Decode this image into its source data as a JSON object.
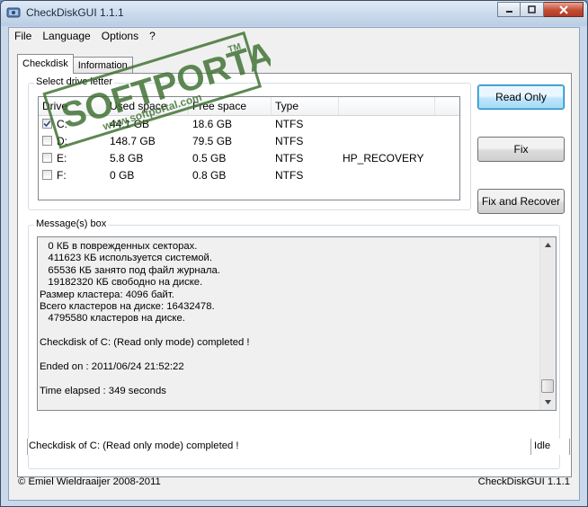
{
  "window": {
    "title": "CheckDiskGUI 1.1.1"
  },
  "menu": {
    "items": [
      "File",
      "Language",
      "Options",
      "?"
    ]
  },
  "tabs": [
    {
      "label": "Checkdisk",
      "active": true
    },
    {
      "label": "Information",
      "active": false
    }
  ],
  "drives": {
    "group_label": "Select drive letter",
    "columns": [
      "Drive",
      "Used space",
      "Free space",
      "Type",
      ""
    ],
    "rows": [
      {
        "drive": "C:",
        "used": "44.1 GB",
        "free": "18.6 GB",
        "type": "NTFS",
        "label": "",
        "checked": true
      },
      {
        "drive": "D:",
        "used": "148.7 GB",
        "free": "79.5 GB",
        "type": "NTFS",
        "label": "",
        "checked": false
      },
      {
        "drive": "E:",
        "used": "5.8 GB",
        "free": "0.5 GB",
        "type": "NTFS",
        "label": "HP_RECOVERY",
        "checked": false
      },
      {
        "drive": "F:",
        "used": "0 GB",
        "free": "0.8 GB",
        "type": "NTFS",
        "label": "",
        "checked": false
      }
    ]
  },
  "buttons": {
    "read_only": "Read Only",
    "fix": "Fix",
    "fix_recover": "Fix and Recover"
  },
  "messages": {
    "group_label": "Message(s) box",
    "lines": [
      "   0 КБ в поврежденных секторах.",
      "   411623 КБ используется системой.",
      "   65536 КБ занято под файл журнала.",
      "   19182320 КБ свободно на диске.",
      "Размер кластера: 4096 байт.",
      "Всего кластеров на диске: 16432478.",
      "   4795580 кластеров на диске.",
      "",
      "Checkdisk of C: (Read only mode) completed !",
      "",
      "Ended on : 2011/06/24 21:52:22",
      "",
      "Time elapsed : 349 seconds"
    ]
  },
  "status": {
    "message": "Checkdisk of C: (Read only mode) completed !",
    "state": "Idle"
  },
  "footer": {
    "copyright": "© Emiel Wieldraaijer 2008-2011",
    "version": "CheckDiskGUI 1.1.1"
  },
  "watermark": {
    "brand": "SOFTPORTAL",
    "tm": "TM",
    "url": "www.softportal.com"
  },
  "colors": {
    "default_button_border": "#3c7fb1",
    "close_button": "#c24d35",
    "watermark": "#3b6e2e"
  }
}
